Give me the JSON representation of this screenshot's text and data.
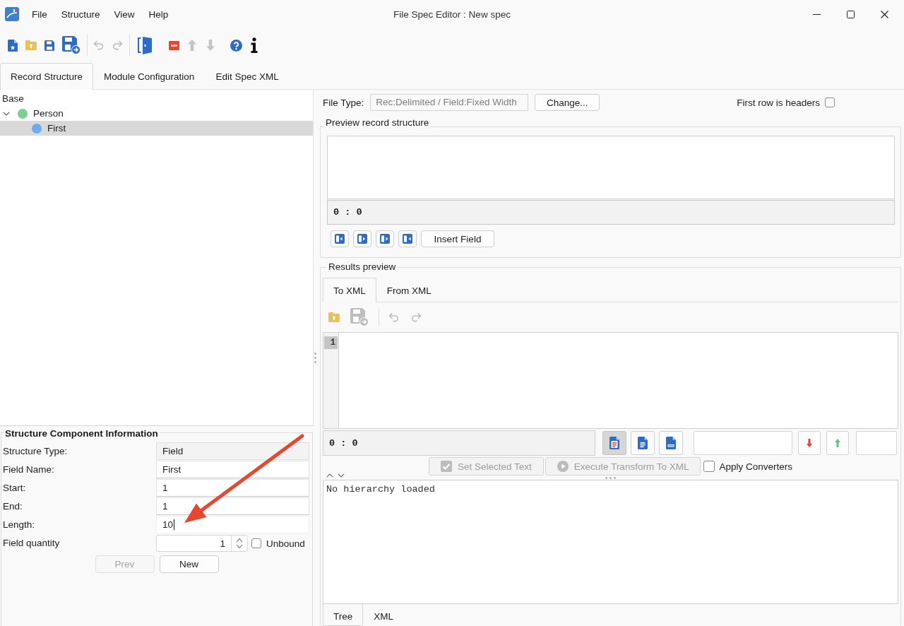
{
  "window": {
    "title": "File Spec Editor : New spec"
  },
  "menu": [
    "File",
    "Structure",
    "View",
    "Help"
  ],
  "toolbar": [
    {
      "kind": "new",
      "disabled": false
    },
    {
      "kind": "open",
      "disabled": false
    },
    {
      "kind": "save",
      "disabled": false
    },
    {
      "kind": "saveas",
      "disabled": false
    },
    {
      "kind": "separator"
    },
    {
      "kind": "undo",
      "disabled": true
    },
    {
      "kind": "redo",
      "disabled": true
    },
    {
      "kind": "separator"
    },
    {
      "kind": "exit",
      "disabled": false
    },
    {
      "kind": "delete",
      "disabled": false
    },
    {
      "kind": "up",
      "disabled": true
    },
    {
      "kind": "down",
      "disabled": true
    },
    {
      "kind": "help",
      "disabled": false
    },
    {
      "kind": "info",
      "disabled": false
    }
  ],
  "tabs": [
    {
      "label": "Record Structure",
      "selected": true
    },
    {
      "label": "Module Configuration",
      "selected": false
    },
    {
      "label": "Edit Spec XML",
      "selected": false
    }
  ],
  "tree": {
    "header": "Base",
    "items": [
      {
        "label": "Person",
        "color": "#7ccf8c",
        "expanded": true,
        "selected": false,
        "children": [
          {
            "label": "First",
            "color": "#6faaf0",
            "selected": true
          }
        ]
      }
    ]
  },
  "component_info": {
    "title": "Structure Component Information",
    "fields": [
      {
        "label": "Structure Type:",
        "value": "Field",
        "readonly": true,
        "focused": false
      },
      {
        "label": "Field Name:",
        "value": "First",
        "readonly": false,
        "focused": false
      },
      {
        "label": "Start:",
        "value": "1",
        "readonly": false,
        "focused": false
      },
      {
        "label": "End:",
        "value": "1",
        "readonly": false,
        "focused": false
      },
      {
        "label": "Length:",
        "value": "10",
        "readonly": false,
        "focused": true
      }
    ],
    "quantity": {
      "label": "Field quantity",
      "value": "1"
    },
    "unbound": {
      "label": "Unbound",
      "checked": false
    },
    "buttons": [
      {
        "label": "Prev",
        "disabled": true
      },
      {
        "label": "New",
        "disabled": false
      }
    ]
  },
  "file_type": {
    "label": "File Type:",
    "value": "Rec:Delimited / Field:Fixed Width",
    "disabled": true
  },
  "change_button": "Change...",
  "first_row_headers": {
    "label": "First row is headers",
    "checked": false
  },
  "preview_record": {
    "title": "Preview record structure",
    "position": "0 : 0",
    "insert_button": "Insert Field"
  },
  "results_preview": {
    "title": "Results preview",
    "tabs": [
      {
        "label": "To XML",
        "selected": true
      },
      {
        "label": "From XML",
        "selected": false
      }
    ],
    "toolbar": [
      {
        "kind": "open",
        "disabled": false
      },
      {
        "kind": "saveas",
        "disabled": true
      },
      {
        "kind": "separator"
      },
      {
        "kind": "undo",
        "disabled": true
      },
      {
        "kind": "redo",
        "disabled": true
      }
    ],
    "line_numbers": [
      "1"
    ],
    "position": "0 : 0",
    "format_buttons": [
      {
        "kind": "text",
        "selected": true
      },
      {
        "kind": "doc",
        "selected": false
      },
      {
        "kind": "html",
        "selected": false
      }
    ],
    "set_button": {
      "label": "Set Selected Text",
      "disabled": true
    },
    "execute_button": {
      "label": "Execute Transform To XML",
      "disabled": true
    },
    "apply_converters": {
      "label": "Apply Converters",
      "checked": false
    },
    "output": "No hierarchy loaded",
    "bottom_tabs": [
      {
        "label": "Tree",
        "selected": true
      },
      {
        "label": "XML",
        "selected": false
      }
    ]
  },
  "annotations": [
    {
      "kind": "arrow"
    }
  ]
}
